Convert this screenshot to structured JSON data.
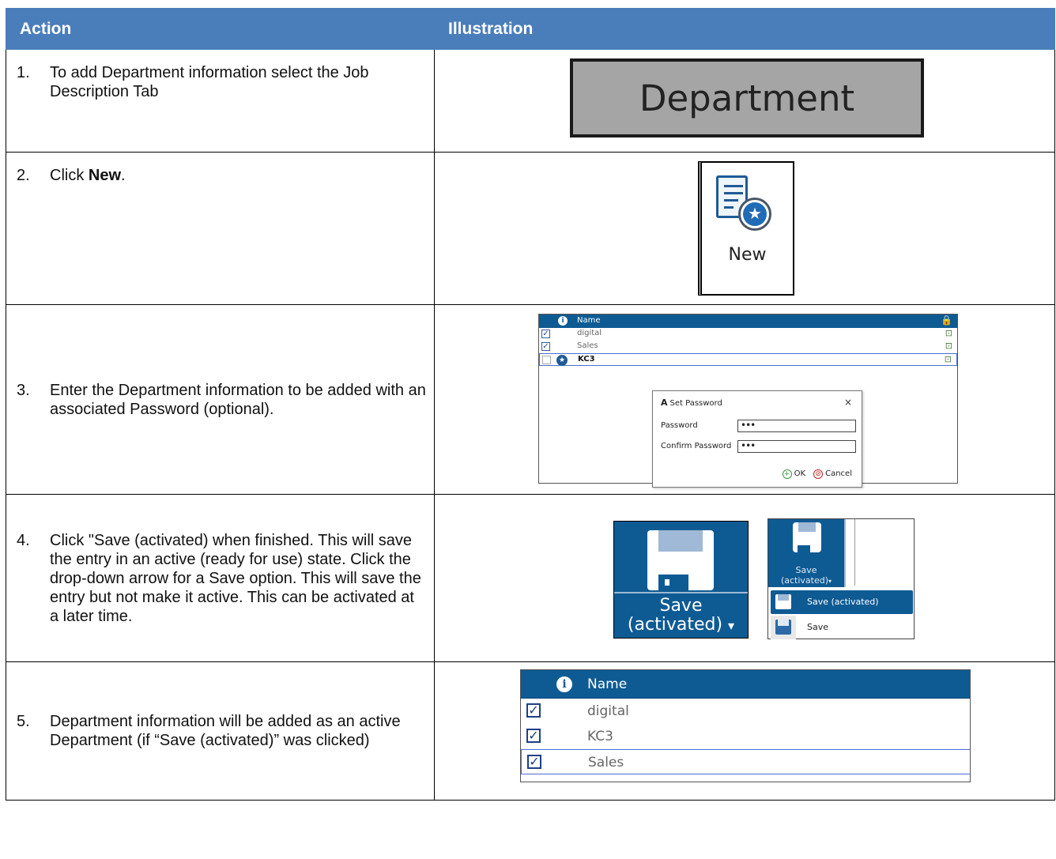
{
  "header": {
    "col_action": "Action",
    "col_illustration": "Illustration"
  },
  "steps": [
    {
      "num": "1.",
      "text": "To add Department information select the Job Description Tab"
    },
    {
      "num": "2.",
      "text_before": "Click ",
      "bold": "New",
      "text_after": "."
    },
    {
      "num": "3.",
      "text": "Enter the Department information to be added with an associated Password (optional)."
    },
    {
      "num": "4.",
      "text": "Click \"Save (activated) when finished. This will save the entry in an active (ready for use) state. Click the drop-down arrow for a Save option. This will save the entry but not make it active. This can be activated at a later time."
    },
    {
      "num": "5.",
      "text": "Department information will be added as an active Department (if “Save (activated)” was clicked)"
    }
  ],
  "illus1": {
    "tab_label": "Department"
  },
  "illus2": {
    "button_label": "New",
    "icon": "new-document-star-icon"
  },
  "illus3": {
    "column_name": "Name",
    "rows": [
      {
        "name": "digital",
        "checked": true
      },
      {
        "name": "Sales",
        "checked": true
      },
      {
        "name": "KC3",
        "checked": false,
        "is_new": true
      }
    ],
    "dialog": {
      "title_prefix": "A",
      "title": "Set Password",
      "close": "×",
      "password_label": "Password",
      "password_value": "•••",
      "confirm_label": "Confirm Password",
      "confirm_value": "•••",
      "ok_label": "OK",
      "cancel_label": "Cancel"
    }
  },
  "illus4": {
    "big_button_line1": "Save",
    "big_button_line2": "(activated)",
    "big_button_arrow": "▾",
    "small_button_line1": "Save",
    "small_button_line2": "(activated)",
    "menu_items": [
      "Save (activated)",
      "Save"
    ]
  },
  "illus5": {
    "column_name": "Name",
    "rows": [
      {
        "name": "digital",
        "checked": true
      },
      {
        "name": "KC3",
        "checked": true
      },
      {
        "name": "Sales",
        "checked": true
      }
    ]
  },
  "colors": {
    "header_bg": "#4a7ebb",
    "app_blue": "#0e5b94",
    "tab_gray": "#a5a5a5"
  }
}
